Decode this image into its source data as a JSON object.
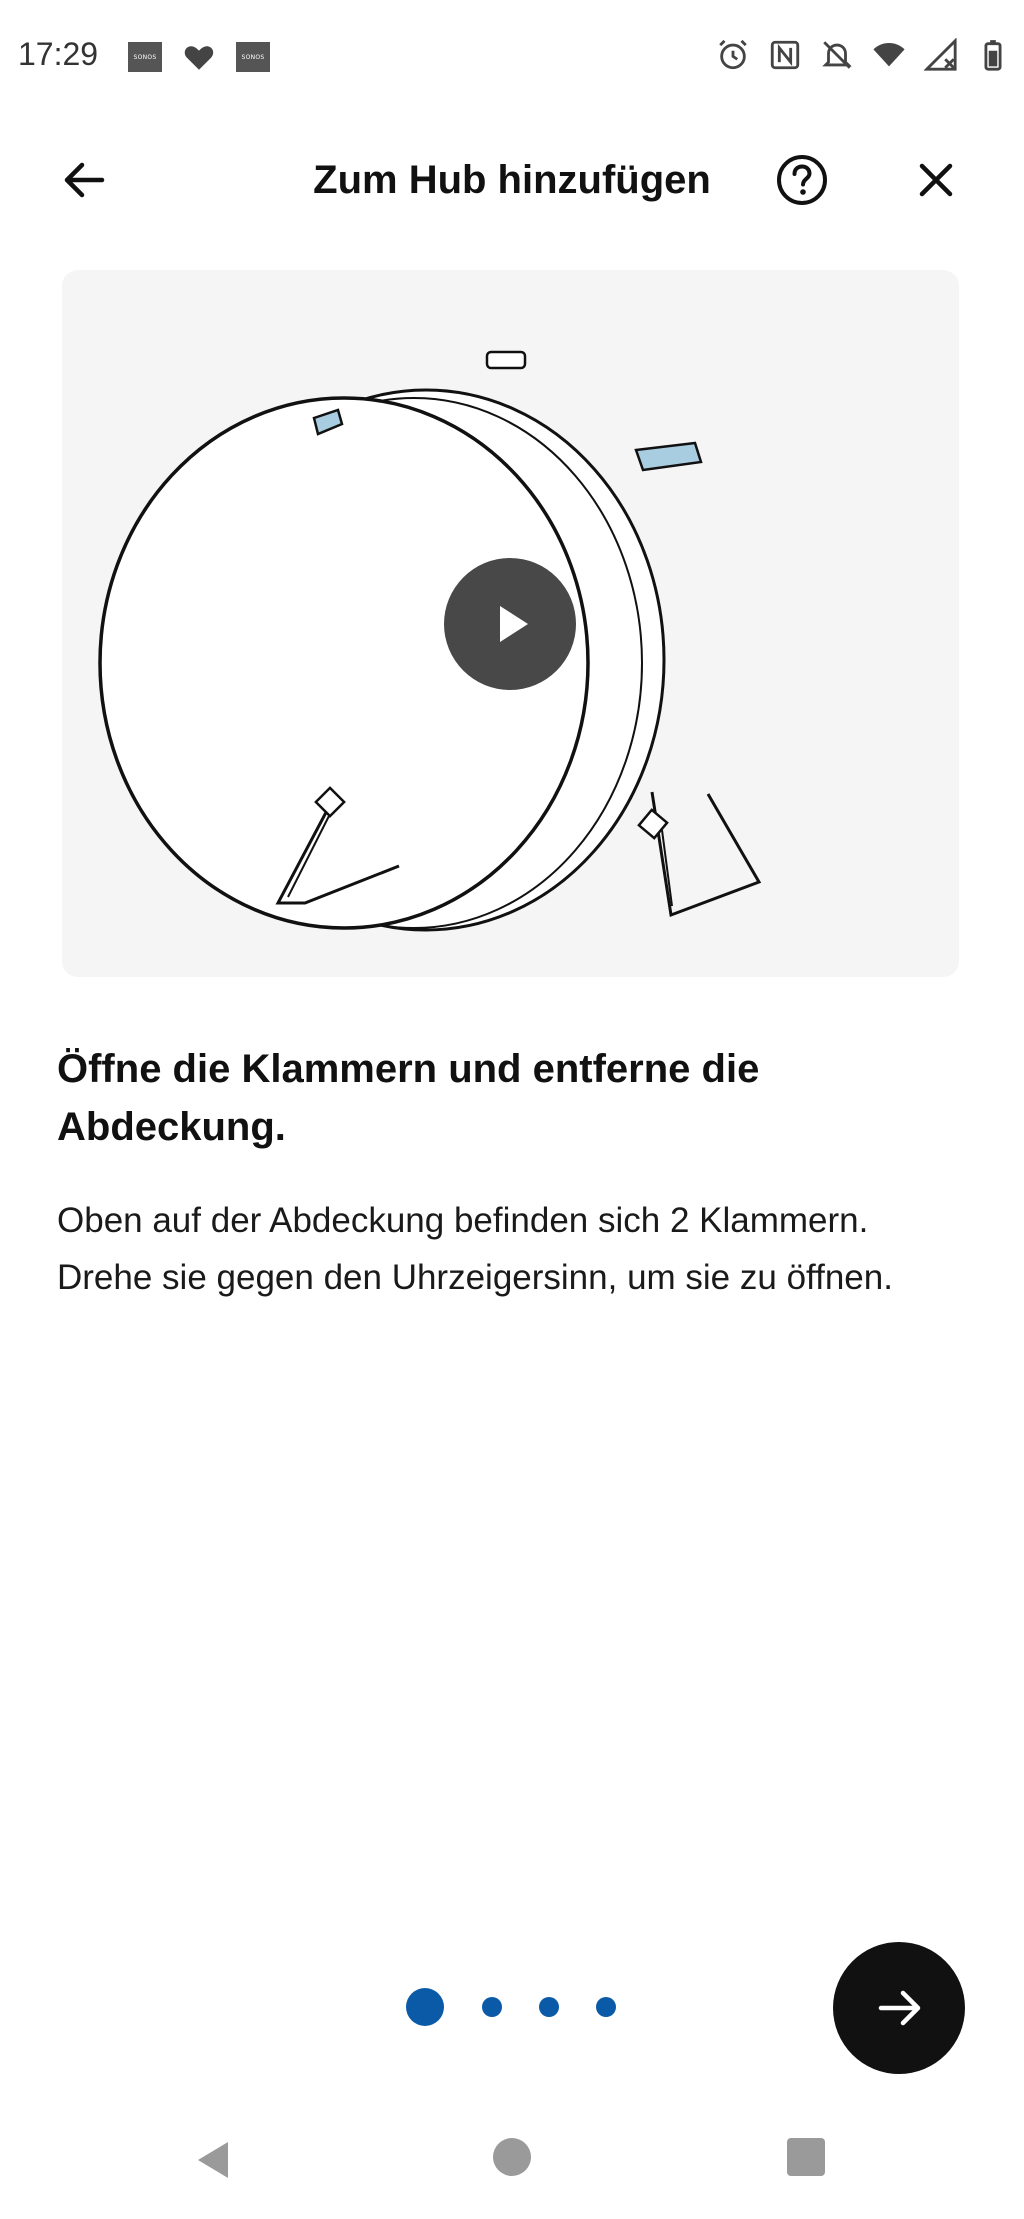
{
  "status_bar": {
    "time": "17:29",
    "left_icons": [
      "sonos-icon",
      "heart-icon",
      "sonos-icon"
    ],
    "sonos_label": "SONOS",
    "right_icons": [
      "alarm-icon",
      "nfc-icon",
      "notifications-off-icon",
      "wifi-icon",
      "signal-icon",
      "battery-icon"
    ]
  },
  "app_bar": {
    "title": "Zum Hub hinzufügen",
    "back_icon": "arrow-left-icon",
    "help_icon": "help-circle-icon",
    "close_icon": "close-icon"
  },
  "media": {
    "play_icon": "play-icon"
  },
  "content": {
    "heading": "Öffne die Klammern und entferne die Abdeckung.",
    "body": "Oben auf der Abdeckung befinden sich 2 Klammern. Drehe sie gegen den Uhrzeigersinn, um sie zu öffnen."
  },
  "pager": {
    "total_pages": 4,
    "current_page": 1
  },
  "next_button": {
    "icon": "arrow-right-icon"
  },
  "nav_bar": {
    "icons": [
      "nav-back-icon",
      "nav-home-icon",
      "nav-recents-icon"
    ]
  },
  "colors": {
    "accent": "#0b5aa8",
    "fab": "#111111",
    "card_background": "#f5f5f5",
    "clip_blue": "#a9cde0"
  }
}
